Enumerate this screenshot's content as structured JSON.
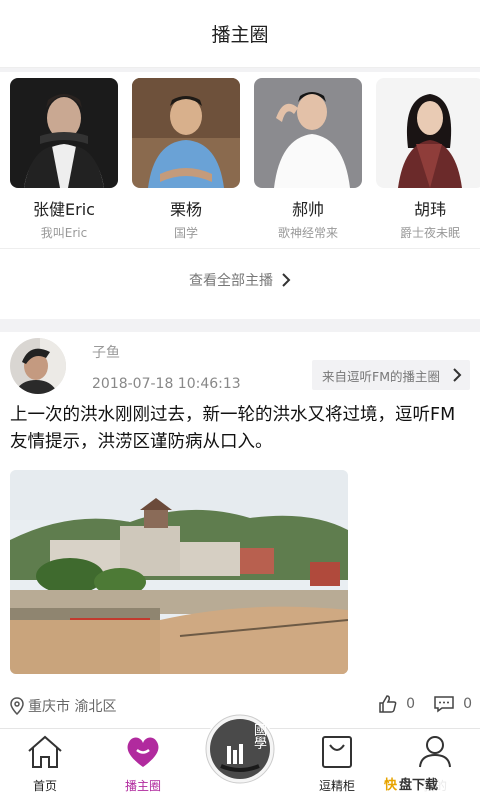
{
  "header": {
    "title": "播主圈"
  },
  "hosts": [
    {
      "name": "张健Eric",
      "desc": "我叫Eric"
    },
    {
      "name": "栗杨",
      "desc": "国学"
    },
    {
      "name": "郝帅",
      "desc": "歌神经常来"
    },
    {
      "name": "胡玮",
      "desc": "爵士夜未眠"
    }
  ],
  "view_all_label": "查看全部主播",
  "post": {
    "user": "子鱼",
    "time": "2018-07-18 10:46:13",
    "source": "来自逗听FM的播主圈",
    "text": "上一次的洪水刚刚过去，新一轮的洪水又将过境，逗听FM友情提示，洪涝区谨防病从口入。",
    "location": "重庆市 渝北区",
    "likes": "0",
    "comments": "0"
  },
  "tabs": [
    {
      "label": "首页",
      "icon": "home-icon"
    },
    {
      "label": "播主圈",
      "icon": "heart-icon",
      "active": true
    },
    {
      "label": "逗精柜",
      "icon": "bag-icon"
    },
    {
      "label": "我的",
      "icon": "user-icon"
    }
  ],
  "center_badge_text": "國學",
  "watermark": {
    "text1": "快",
    "text2": "盘下载"
  },
  "colors": {
    "accent": "#b12a9e",
    "tab_icon": "#333333"
  }
}
